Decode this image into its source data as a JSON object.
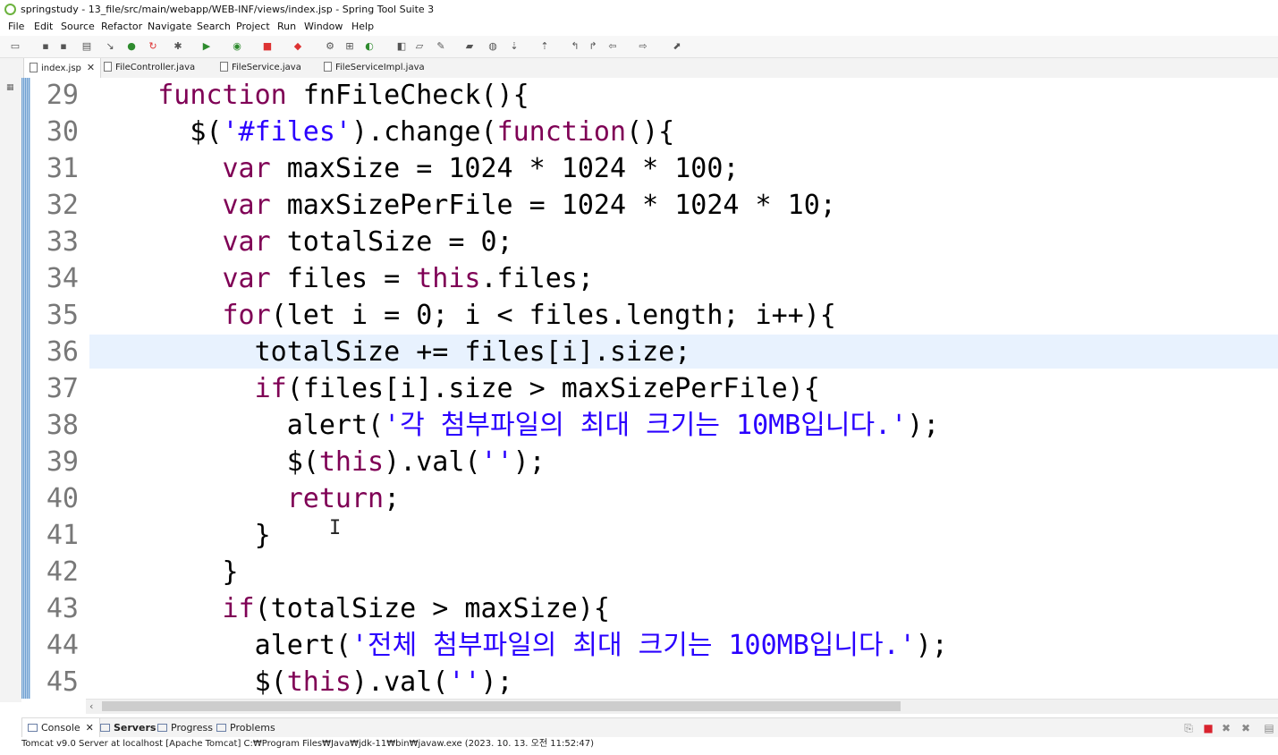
{
  "window": {
    "title": "springstudy - 13_file/src/main/webapp/WEB-INF/views/index.jsp - Spring Tool Suite 3",
    "app_icon": "spring-logo-icon",
    "accent_color": "#6db33f"
  },
  "menu": [
    "File",
    "Edit",
    "Source",
    "Refactor",
    "Navigate",
    "Search",
    "Project",
    "Run",
    "Window",
    "Help"
  ],
  "editor_tabs": [
    {
      "label": "index.jsp",
      "active": true,
      "closable": true
    },
    {
      "label": "FileController.java",
      "active": false
    },
    {
      "label": "FileService.java",
      "active": false
    },
    {
      "label": "FileServiceImpl.java",
      "active": false
    }
  ],
  "code": {
    "current_line": 36,
    "lines": [
      {
        "n": "29",
        "tokens": [
          {
            "t": "    "
          },
          {
            "t": "function",
            "k": "kw"
          },
          {
            "t": " fnFileCheck(){"
          }
        ]
      },
      {
        "n": "30",
        "tokens": [
          {
            "t": "      $("
          },
          {
            "t": "'#files'",
            "k": "str"
          },
          {
            "t": ").change("
          },
          {
            "t": "function",
            "k": "kw"
          },
          {
            "t": "(){"
          }
        ]
      },
      {
        "n": "31",
        "tokens": [
          {
            "t": "        "
          },
          {
            "t": "var",
            "k": "kw"
          },
          {
            "t": " maxSize = 1024 * 1024 * 100;"
          }
        ]
      },
      {
        "n": "32",
        "tokens": [
          {
            "t": "        "
          },
          {
            "t": "var",
            "k": "kw"
          },
          {
            "t": " maxSizePerFile = 1024 * 1024 * 10;"
          }
        ]
      },
      {
        "n": "33",
        "tokens": [
          {
            "t": "        "
          },
          {
            "t": "var",
            "k": "kw"
          },
          {
            "t": " totalSize = 0;"
          }
        ]
      },
      {
        "n": "34",
        "tokens": [
          {
            "t": "        "
          },
          {
            "t": "var",
            "k": "kw"
          },
          {
            "t": " files = "
          },
          {
            "t": "this",
            "k": "kw"
          },
          {
            "t": ".files;"
          }
        ]
      },
      {
        "n": "35",
        "tokens": [
          {
            "t": "        "
          },
          {
            "t": "for",
            "k": "kw"
          },
          {
            "t": "(let i = 0; i < files.length; i++){"
          }
        ]
      },
      {
        "n": "36",
        "tokens": [
          {
            "t": "          totalSize += files[i].size;"
          }
        ]
      },
      {
        "n": "37",
        "tokens": [
          {
            "t": "          "
          },
          {
            "t": "if",
            "k": "kw"
          },
          {
            "t": "(files[i].size > maxSizePerFile){"
          }
        ]
      },
      {
        "n": "38",
        "tokens": [
          {
            "t": "            alert("
          },
          {
            "t": "'각 첨부파일의 최대 크기는 10MB입니다.'",
            "k": "str"
          },
          {
            "t": ");"
          }
        ]
      },
      {
        "n": "39",
        "tokens": [
          {
            "t": "            $("
          },
          {
            "t": "this",
            "k": "kw"
          },
          {
            "t": ").val("
          },
          {
            "t": "''",
            "k": "str"
          },
          {
            "t": ");"
          }
        ]
      },
      {
        "n": "40",
        "tokens": [
          {
            "t": "            "
          },
          {
            "t": "return",
            "k": "kw"
          },
          {
            "t": ";"
          }
        ]
      },
      {
        "n": "41",
        "tokens": [
          {
            "t": "          }"
          }
        ]
      },
      {
        "n": "42",
        "tokens": [
          {
            "t": "        }"
          }
        ]
      },
      {
        "n": "43",
        "tokens": [
          {
            "t": "        "
          },
          {
            "t": "if",
            "k": "kw"
          },
          {
            "t": "(totalSize > maxSize){"
          }
        ]
      },
      {
        "n": "44",
        "tokens": [
          {
            "t": "          alert("
          },
          {
            "t": "'전체 첨부파일의 최대 크기는 100MB입니다.'",
            "k": "str"
          },
          {
            "t": ");"
          }
        ]
      },
      {
        "n": "45",
        "tokens": [
          {
            "t": "          $("
          },
          {
            "t": "this",
            "k": "kw"
          },
          {
            "t": ").val("
          },
          {
            "t": "''",
            "k": "str"
          },
          {
            "t": ");"
          }
        ]
      }
    ],
    "colors": {
      "keyword": "#7f0055",
      "string": "#2a00ff",
      "line_number": "#787878",
      "current_line": "#e8f2fe"
    }
  },
  "bottom_panel": {
    "tabs": [
      {
        "label": "Console",
        "active": true,
        "closable": true
      },
      {
        "label": "Servers",
        "bold": true
      },
      {
        "label": "Progress"
      },
      {
        "label": "Problems"
      }
    ],
    "status": "Tomcat v9.0 Server at localhost [Apache Tomcat] C:₩Program Files₩Java₩jdk-11₩bin₩javaw.exe  (2023. 10. 13. 오전 11:52:47)"
  }
}
